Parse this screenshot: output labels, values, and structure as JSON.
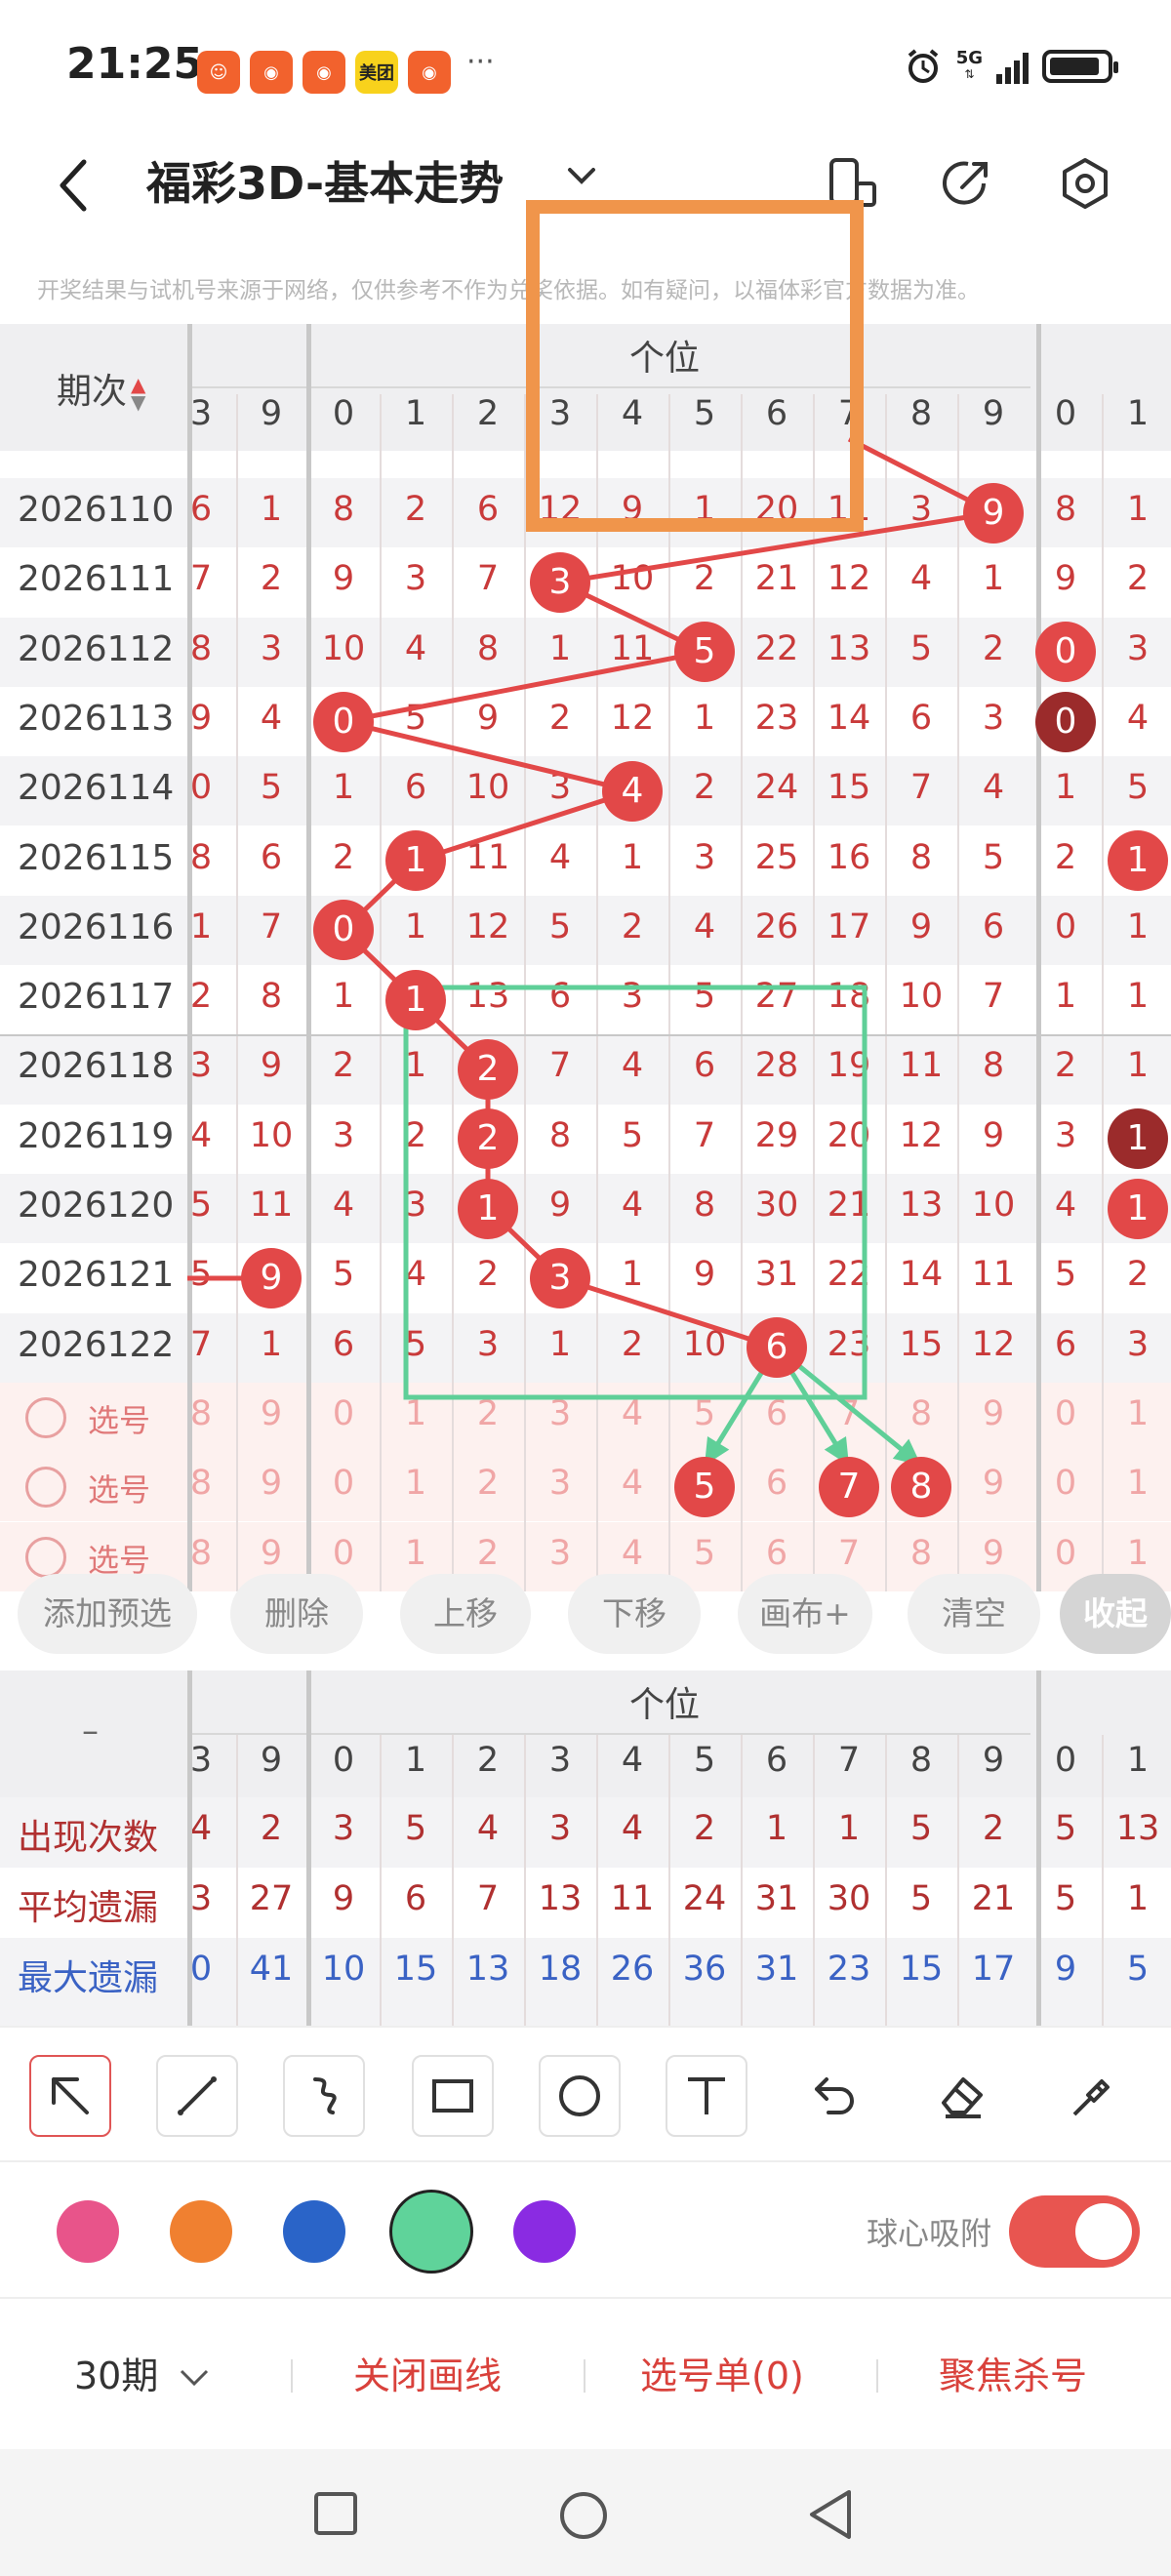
{
  "status_bar": {
    "time": "21:25",
    "apps": [
      {
        "name": "app-1",
        "label": "☺",
        "color": "#f2622d"
      },
      {
        "name": "app-2",
        "label": "◉",
        "color": "#f2622d"
      },
      {
        "name": "app-3",
        "label": "◉",
        "color": "#f2622d"
      },
      {
        "name": "meituan",
        "label": "美团",
        "color": "#f8d21c"
      },
      {
        "name": "app-5",
        "label": "◉",
        "color": "#f2622d"
      }
    ],
    "more": "···",
    "network": "5G"
  },
  "header": {
    "title": "福彩3D-基本走势",
    "notice": "开奖结果与试机号来源于网络，仅供参考不作为兑奖依据。如有疑问，以福体彩官方数据为准。"
  },
  "colors": {
    "accent_red": "#e24848",
    "dark_red": "#9b2b2b",
    "orange_box": "#f0954b",
    "green_box": "#5fcf98"
  },
  "table": {
    "period_header": "期次",
    "group_header": "个位",
    "digit_headers": [
      "3",
      "9",
      "0",
      "1",
      "2",
      "3",
      "4",
      "5",
      "6",
      "7",
      "8",
      "9",
      "0",
      "1"
    ],
    "rows": [
      {
        "period": "2026110",
        "cells": [
          "6",
          "1",
          "8",
          "2",
          "6",
          "12",
          "9",
          "1",
          "20",
          "11",
          "3",
          "9",
          "8",
          "1"
        ]
      },
      {
        "period": "2026111",
        "cells": [
          "7",
          "2",
          "9",
          "3",
          "7",
          "3",
          "10",
          "2",
          "21",
          "12",
          "4",
          "1",
          "9",
          "2"
        ]
      },
      {
        "period": "2026112",
        "cells": [
          "8",
          "3",
          "10",
          "4",
          "8",
          "1",
          "11",
          "5",
          "22",
          "13",
          "5",
          "2",
          "0",
          "3"
        ]
      },
      {
        "period": "2026113",
        "cells": [
          "9",
          "4",
          "0",
          "5",
          "9",
          "2",
          "12",
          "1",
          "23",
          "14",
          "6",
          "3",
          "0",
          "4"
        ]
      },
      {
        "period": "2026114",
        "cells": [
          "0",
          "5",
          "1",
          "6",
          "10",
          "3",
          "4",
          "2",
          "24",
          "15",
          "7",
          "4",
          "1",
          "5"
        ]
      },
      {
        "period": "2026115",
        "cells": [
          "8",
          "6",
          "2",
          "1",
          "11",
          "4",
          "1",
          "3",
          "25",
          "16",
          "8",
          "5",
          "2",
          "1"
        ]
      },
      {
        "period": "2026116",
        "cells": [
          "1",
          "7",
          "0",
          "1",
          "12",
          "5",
          "2",
          "4",
          "26",
          "17",
          "9",
          "6",
          "0",
          "1"
        ]
      },
      {
        "period": "2026117",
        "cells": [
          "2",
          "8",
          "1",
          "1",
          "13",
          "6",
          "3",
          "5",
          "27",
          "18",
          "10",
          "7",
          "1",
          "1"
        ]
      },
      {
        "period": "2026118",
        "cells": [
          "3",
          "9",
          "2",
          "1",
          "2",
          "7",
          "4",
          "6",
          "28",
          "19",
          "11",
          "8",
          "2",
          "1"
        ]
      },
      {
        "period": "2026119",
        "cells": [
          "4",
          "10",
          "3",
          "2",
          "2",
          "8",
          "5",
          "7",
          "29",
          "20",
          "12",
          "9",
          "3",
          "1"
        ]
      },
      {
        "period": "2026120",
        "cells": [
          "5",
          "11",
          "4",
          "3",
          "1",
          "9",
          "4",
          "8",
          "30",
          "21",
          "13",
          "10",
          "4",
          "1"
        ]
      },
      {
        "period": "2026121",
        "cells": [
          "5",
          "9",
          "5",
          "4",
          "2",
          "3",
          "1",
          "9",
          "31",
          "22",
          "14",
          "11",
          "5",
          "2"
        ]
      },
      {
        "period": "2026122",
        "cells": [
          "7",
          "1",
          "6",
          "5",
          "3",
          "1",
          "2",
          "10",
          "6",
          "23",
          "15",
          "12",
          "6",
          "3"
        ]
      }
    ],
    "pick_label": "选号",
    "pick_digits": [
      "8",
      "9",
      "0",
      "1",
      "2",
      "3",
      "4",
      "5",
      "6",
      "7",
      "8",
      "9",
      "0",
      "1"
    ]
  },
  "actions": [
    "添加预选",
    "删除",
    "上移",
    "下移",
    "画布+",
    "清空",
    "收起"
  ],
  "stats": {
    "dash": "–",
    "group_header": "个位",
    "digit_headers": [
      "3",
      "9",
      "0",
      "1",
      "2",
      "3",
      "4",
      "5",
      "6",
      "7",
      "8",
      "9",
      "0",
      "1"
    ],
    "rows": [
      {
        "label": "出现次数",
        "color": "#b03030",
        "values": [
          "4",
          "2",
          "3",
          "5",
          "4",
          "3",
          "4",
          "2",
          "1",
          "1",
          "5",
          "2",
          "5",
          "13"
        ]
      },
      {
        "label": "平均遗漏",
        "color": "#b03030",
        "values": [
          "3",
          "27",
          "9",
          "6",
          "7",
          "13",
          "11",
          "24",
          "31",
          "30",
          "5",
          "21",
          "5",
          "1"
        ]
      },
      {
        "label": "最大遗漏",
        "color": "#3a62c4",
        "values": [
          "0",
          "41",
          "10",
          "15",
          "13",
          "18",
          "26",
          "36",
          "31",
          "23",
          "15",
          "17",
          "9",
          "5"
        ]
      }
    ]
  },
  "tools": [
    "pointer-tool",
    "line-tool",
    "freehand-tool",
    "rectangle-tool",
    "circle-tool",
    "text-tool",
    "undo-tool",
    "eraser-tool",
    "brush-tool"
  ],
  "palette": [
    "#e8548a",
    "#f08030",
    "#2a64c8",
    "#5fd39a",
    "#8a2be2"
  ],
  "snap": {
    "label": "球心吸附",
    "on": true
  },
  "bottom_bar": {
    "period_select": "30期",
    "close_lines": "关闭画线",
    "pick_list": "选号单(0)",
    "focus_kill": "聚焦杀号"
  }
}
